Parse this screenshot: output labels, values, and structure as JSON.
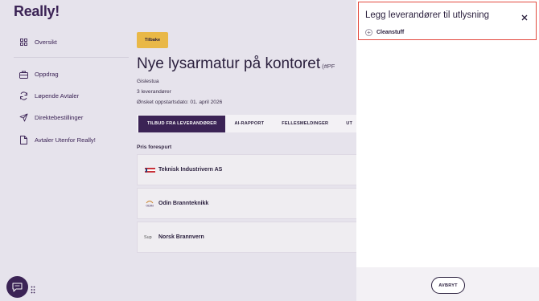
{
  "app": {
    "logo_text": "Really!"
  },
  "sidebar": {
    "items": [
      {
        "label": "Oversikt",
        "icon": "grid-icon"
      },
      {
        "label": "Oppdrag",
        "icon": "briefcase-icon"
      },
      {
        "label": "Løpende Avtaler",
        "icon": "refresh-icon"
      },
      {
        "label": "Direktebestillinger",
        "icon": "send-icon"
      },
      {
        "label": "Avtaler Utenfor Really!",
        "icon": "document-icon"
      }
    ]
  },
  "main": {
    "back_label": "Tilbake",
    "title": "Nye lysarmatur på kontoret",
    "title_code": "(#PF",
    "location": "Gislestua",
    "supplier_count": "3 leverandører",
    "start_date": "Ønsket oppstartsdato: 01. april 2026",
    "tabs": [
      {
        "label": "TILBUD FRA LEVERANDØRER",
        "active": true
      },
      {
        "label": "AI-RAPPORT",
        "active": false
      },
      {
        "label": "FELLESMELDINGER",
        "active": false
      },
      {
        "label": "UT",
        "active": false
      }
    ],
    "section_label": "Pris forespurt",
    "suppliers": [
      {
        "name": "Teknisk Industrivern AS",
        "logo": "flag-logo"
      },
      {
        "name": "Odin Brannteknikk",
        "logo": "odin-logo",
        "logo_text": "ODIN"
      },
      {
        "name": "Norsk Brannvern",
        "logo": "broken-image",
        "logo_text": "Sup"
      }
    ]
  },
  "panel": {
    "title": "Legg leverandører til utlysning",
    "option_label": "Cleanstuff",
    "cancel_label": "AVBRYT"
  },
  "colors": {
    "brand": "#3b2355",
    "accent": "#e9b847",
    "highlight_border": "#e34a3f",
    "background": "#e6e3ec"
  }
}
